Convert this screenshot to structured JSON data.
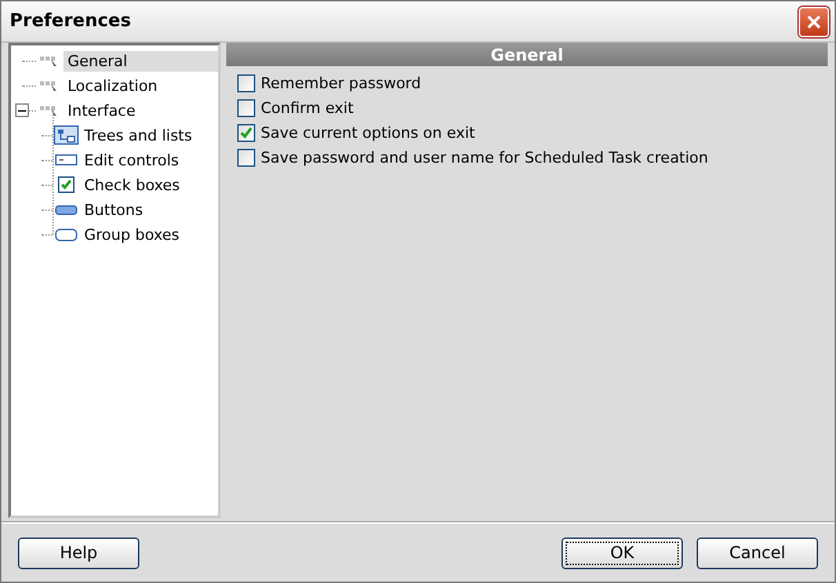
{
  "window": {
    "title": "Preferences"
  },
  "tree": [
    {
      "label": "General",
      "kind": "page",
      "selected": true
    },
    {
      "label": "Localization",
      "kind": "page",
      "selected": false
    },
    {
      "label": "Interface",
      "kind": "page",
      "selected": false,
      "expanded": true,
      "children": [
        {
          "label": "Trees and lists",
          "kind": "trees",
          "selected": false
        },
        {
          "label": "Edit controls",
          "kind": "edit",
          "selected": false
        },
        {
          "label": "Check boxes",
          "kind": "check",
          "selected": false
        },
        {
          "label": "Buttons",
          "kind": "button",
          "selected": false
        },
        {
          "label": "Group boxes",
          "kind": "group",
          "selected": false
        }
      ]
    }
  ],
  "panel": {
    "title": "General",
    "options": [
      {
        "label": "Remember password",
        "checked": false
      },
      {
        "label": "Confirm exit",
        "checked": false
      },
      {
        "label": "Save current options on exit",
        "checked": true
      },
      {
        "label": "Save password and user name for Scheduled Task creation",
        "checked": false
      }
    ]
  },
  "buttons": [
    {
      "label": "Help",
      "default": false
    },
    {
      "label": "OK",
      "default": true
    },
    {
      "label": "Cancel",
      "default": false
    }
  ]
}
